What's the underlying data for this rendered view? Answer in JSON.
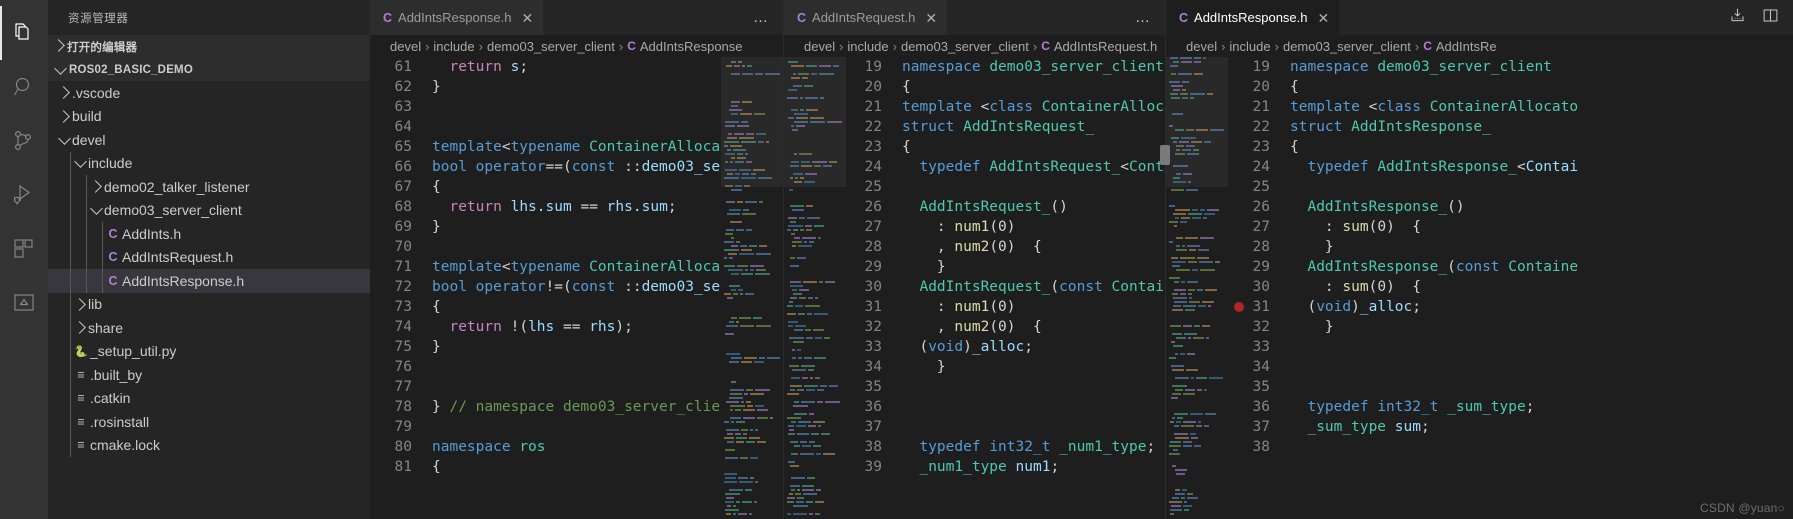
{
  "activity_bar": {
    "items": [
      {
        "name": "explorer",
        "icon": "files-icon",
        "active": true
      },
      {
        "name": "search",
        "icon": "search-icon",
        "active": false
      },
      {
        "name": "source-control",
        "icon": "source-control-icon",
        "active": false
      },
      {
        "name": "run-and-debug",
        "icon": "run-debug-icon",
        "active": false
      },
      {
        "name": "extensions",
        "icon": "extensions-icon",
        "active": false
      },
      {
        "name": "remote-explorer",
        "icon": "remote-explorer-icon",
        "active": false
      }
    ]
  },
  "sidebar": {
    "title": "资源管理器",
    "open_editors_label": "打开的编辑器",
    "project_label": "ROS02_BASIC_DEMO",
    "tree": [
      {
        "label": ".vscode",
        "indent": 1,
        "kind": "folder",
        "expanded": false
      },
      {
        "label": "build",
        "indent": 1,
        "kind": "folder",
        "expanded": false
      },
      {
        "label": "devel",
        "indent": 1,
        "kind": "folder",
        "expanded": true
      },
      {
        "label": "include",
        "indent": 2,
        "kind": "folder",
        "expanded": true
      },
      {
        "label": "demo02_talker_listener",
        "indent": 3,
        "kind": "folder",
        "expanded": false
      },
      {
        "label": "demo03_server_client",
        "indent": 3,
        "kind": "folder",
        "expanded": true
      },
      {
        "label": "AddInts.h",
        "indent": 4,
        "kind": "file",
        "icon": "c"
      },
      {
        "label": "AddIntsRequest.h",
        "indent": 4,
        "kind": "file",
        "icon": "c"
      },
      {
        "label": "AddIntsResponse.h",
        "indent": 4,
        "kind": "file",
        "icon": "c",
        "selected": true
      },
      {
        "label": "lib",
        "indent": 2,
        "kind": "folder",
        "expanded": false
      },
      {
        "label": "share",
        "indent": 2,
        "kind": "folder",
        "expanded": false
      },
      {
        "label": "_setup_util.py",
        "indent": 2,
        "kind": "file",
        "icon": "py"
      },
      {
        "label": ".built_by",
        "indent": 2,
        "kind": "file",
        "icon": "txt"
      },
      {
        "label": ".catkin",
        "indent": 2,
        "kind": "file",
        "icon": "txt"
      },
      {
        "label": ".rosinstall",
        "indent": 2,
        "kind": "file",
        "icon": "txt"
      },
      {
        "label": "cmake.lock",
        "indent": 2,
        "kind": "file",
        "icon": "txt"
      }
    ]
  },
  "editor_groups": [
    {
      "tab": {
        "label": "AddIntsResponse.h",
        "icon": "c-file-icon",
        "active": false,
        "close": "✕"
      },
      "more_actions": "…",
      "breadcrumb": [
        "devel",
        "include",
        "demo03_server_client",
        "AddIntsResponse"
      ],
      "first_line": 61,
      "lines": [
        {
          "n": 61,
          "text": "  return s;"
        },
        {
          "n": 62,
          "text": "}"
        },
        {
          "n": 63,
          "text": ""
        },
        {
          "n": 64,
          "text": ""
        },
        {
          "n": 65,
          "text": "template<typename ContainerAlloca"
        },
        {
          "n": 66,
          "text": "bool operator==(const ::demo03_se"
        },
        {
          "n": 67,
          "text": "{"
        },
        {
          "n": 68,
          "text": "  return lhs.sum == rhs.sum;"
        },
        {
          "n": 69,
          "text": "}"
        },
        {
          "n": 70,
          "text": ""
        },
        {
          "n": 71,
          "text": "template<typename ContainerAlloca"
        },
        {
          "n": 72,
          "text": "bool operator!=(const ::demo03_se"
        },
        {
          "n": 73,
          "text": "{"
        },
        {
          "n": 74,
          "text": "  return !(lhs == rhs);"
        },
        {
          "n": 75,
          "text": "}"
        },
        {
          "n": 76,
          "text": ""
        },
        {
          "n": 77,
          "text": ""
        },
        {
          "n": 78,
          "text": "} // namespace demo03_server_clie"
        },
        {
          "n": 79,
          "text": ""
        },
        {
          "n": 80,
          "text": "namespace ros"
        },
        {
          "n": 81,
          "text": "{"
        }
      ]
    },
    {
      "tab": {
        "label": "AddIntsRequest.h",
        "icon": "c-file-icon",
        "active": false,
        "close": "✕"
      },
      "more_actions": "…",
      "breadcrumb": [
        "devel",
        "include",
        "demo03_server_client",
        "AddIntsRequest.h"
      ],
      "first_line": 19,
      "lines": [
        {
          "n": 19,
          "text": "namespace demo03_server_client"
        },
        {
          "n": 20,
          "text": "{"
        },
        {
          "n": 21,
          "text": "template <class ContainerAllocato"
        },
        {
          "n": 22,
          "text": "struct AddIntsRequest_"
        },
        {
          "n": 23,
          "text": "{"
        },
        {
          "n": 24,
          "text": "  typedef AddIntsRequest_<Contain"
        },
        {
          "n": 25,
          "text": ""
        },
        {
          "n": 26,
          "text": "  AddIntsRequest_()"
        },
        {
          "n": 27,
          "text": "    : num1(0)"
        },
        {
          "n": 28,
          "text": "    , num2(0)  {"
        },
        {
          "n": 29,
          "text": "    }"
        },
        {
          "n": 30,
          "text": "  AddIntsRequest_(const Container"
        },
        {
          "n": 31,
          "text": "    : num1(0)"
        },
        {
          "n": 32,
          "text": "    , num2(0)  {"
        },
        {
          "n": 33,
          "text": "  (void)_alloc;"
        },
        {
          "n": 34,
          "text": "    }"
        },
        {
          "n": 35,
          "text": ""
        },
        {
          "n": 36,
          "text": ""
        },
        {
          "n": 37,
          "text": ""
        },
        {
          "n": 38,
          "text": "  typedef int32_t _num1_type;"
        },
        {
          "n": 39,
          "text": "  _num1_type num1;"
        }
      ]
    },
    {
      "tab": {
        "label": "AddIntsResponse.h",
        "icon": "c-file-icon",
        "active": true,
        "close": "✕"
      },
      "breadcrumb": [
        "devel",
        "include",
        "demo03_server_client",
        "AddIntsRe"
      ],
      "first_line": 19,
      "breakpoint_line": 31,
      "lines": [
        {
          "n": 19,
          "text": "namespace demo03_server_client"
        },
        {
          "n": 20,
          "text": "{"
        },
        {
          "n": 21,
          "text": "template <class ContainerAllocato"
        },
        {
          "n": 22,
          "text": "struct AddIntsResponse_"
        },
        {
          "n": 23,
          "text": "{"
        },
        {
          "n": 24,
          "text": "  typedef AddIntsResponse_<Contai"
        },
        {
          "n": 25,
          "text": ""
        },
        {
          "n": 26,
          "text": "  AddIntsResponse_()"
        },
        {
          "n": 27,
          "text": "    : sum(0)  {"
        },
        {
          "n": 28,
          "text": "    }"
        },
        {
          "n": 29,
          "text": "  AddIntsResponse_(const Containe"
        },
        {
          "n": 30,
          "text": "    : sum(0)  {"
        },
        {
          "n": 31,
          "text": "  (void)_alloc;"
        },
        {
          "n": 32,
          "text": "    }"
        },
        {
          "n": 33,
          "text": ""
        },
        {
          "n": 34,
          "text": ""
        },
        {
          "n": 35,
          "text": ""
        },
        {
          "n": 36,
          "text": "  typedef int32_t _sum_type;"
        },
        {
          "n": 37,
          "text": "  _sum_type sum;"
        },
        {
          "n": 38,
          "text": ""
        }
      ]
    }
  ],
  "titlebar_actions": [
    {
      "name": "split-download-icon",
      "glyph": "⤓"
    },
    {
      "name": "split-editor-icon",
      "glyph": "▣"
    }
  ],
  "watermark": "CSDN @yuan○",
  "colors": {
    "accent": "#b180d7",
    "background": "#1e1e1e",
    "sidebar_bg": "#252526",
    "activitybar_bg": "#333333",
    "selection": "#37373d",
    "breakpoint": "#b02626"
  }
}
